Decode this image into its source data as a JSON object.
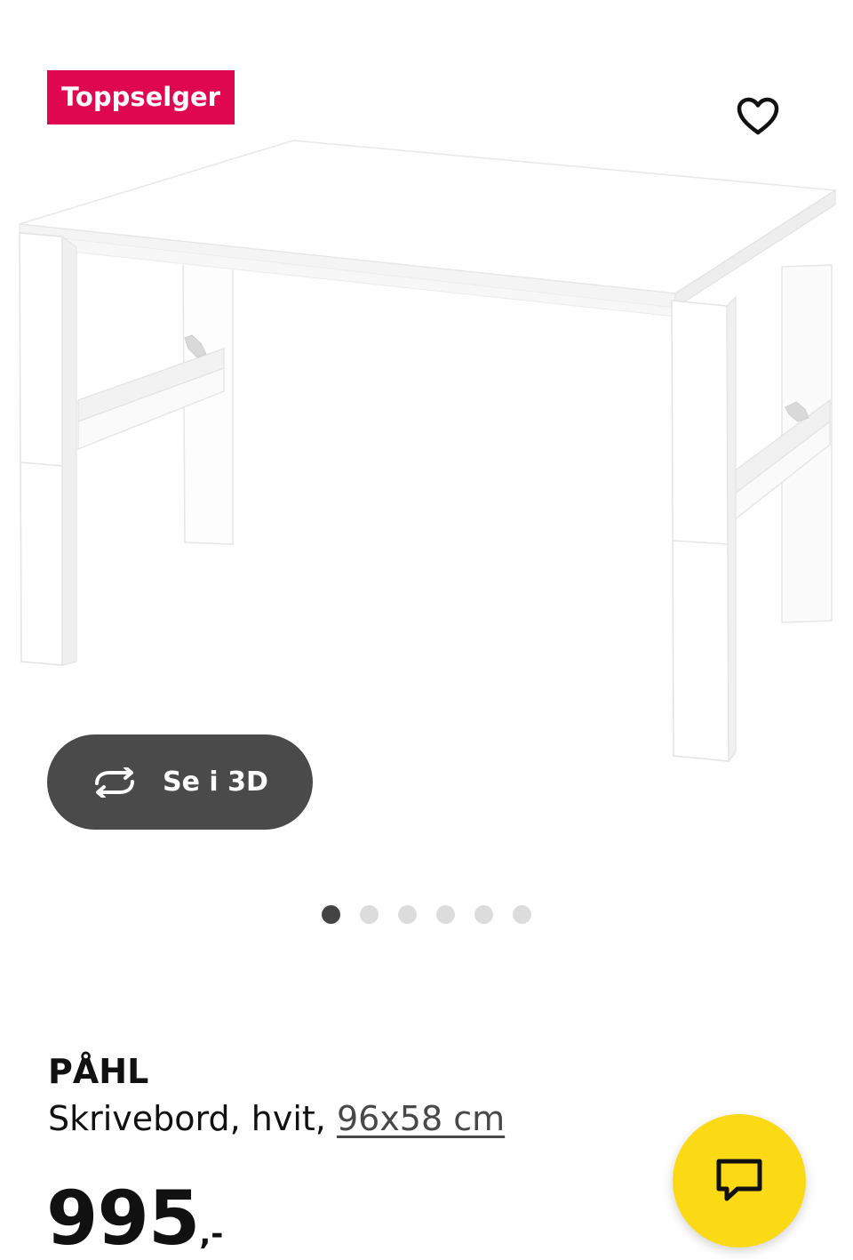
{
  "colors": {
    "badge_bg": "#e00751",
    "pill_bg": "#4a4a4a",
    "fab_bg": "#fbd914",
    "dot_active": "#444444",
    "dot_inactive": "#dcdcdc"
  },
  "gallery": {
    "badge_label": "Toppselger",
    "favorite_icon": "heart-outline-icon",
    "view3d_icon": "rotate-icon",
    "view3d_label": "Se i 3D",
    "image_subject": "product-desk-image",
    "dots_total": 6,
    "dots_active_index": 0
  },
  "product": {
    "name": "PÅHL",
    "description_prefix": "Skrivebord, hvit, ",
    "size_link": "96x58 cm",
    "price_integer": "995",
    "price_suffix": ",-"
  },
  "chat": {
    "icon": "chat-bubble-icon"
  }
}
